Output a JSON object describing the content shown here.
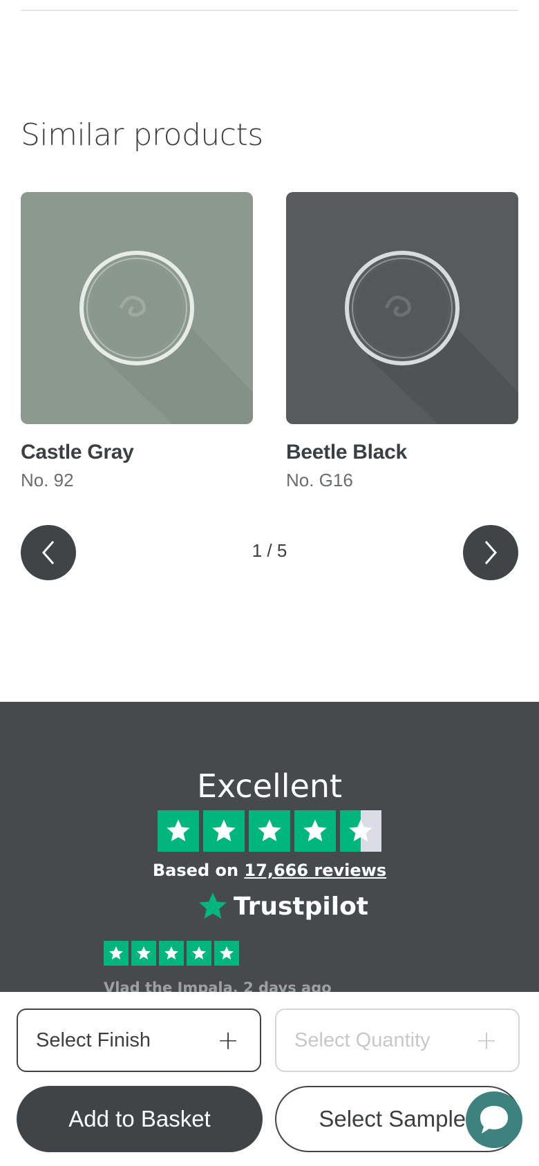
{
  "section": {
    "title": "Similar products"
  },
  "products": [
    {
      "name": "Castle Gray",
      "code": "No. 92",
      "color": "#8c998f",
      "shadow": "#7b877e"
    },
    {
      "name": "Beetle Black",
      "code": "No. G16",
      "color": "#575b5b",
      "shadow": "#4a4d4d"
    }
  ],
  "carousel": {
    "pager": "1 / 5",
    "prev_icon": "chevron-left-icon",
    "next_icon": "chevron-right-icon"
  },
  "trustpilot": {
    "title": "Excellent",
    "rating_stars": 4.5,
    "based_on_prefix": "Based on",
    "reviews_link": "17,666 reviews",
    "brand": "Trustpilot",
    "review": {
      "stars": 5,
      "author_line": "Vlad the Impala, 2 days ago"
    },
    "colors": {
      "green": "#00b67a",
      "background": "#464a4c"
    }
  },
  "actions": {
    "finish_label": "Select Finish",
    "quantity_label": "Select Quantity",
    "add_basket_label": "Add to Basket",
    "select_samples_label": "Select Samples",
    "chat_icon": "chat-bubble-icon"
  }
}
